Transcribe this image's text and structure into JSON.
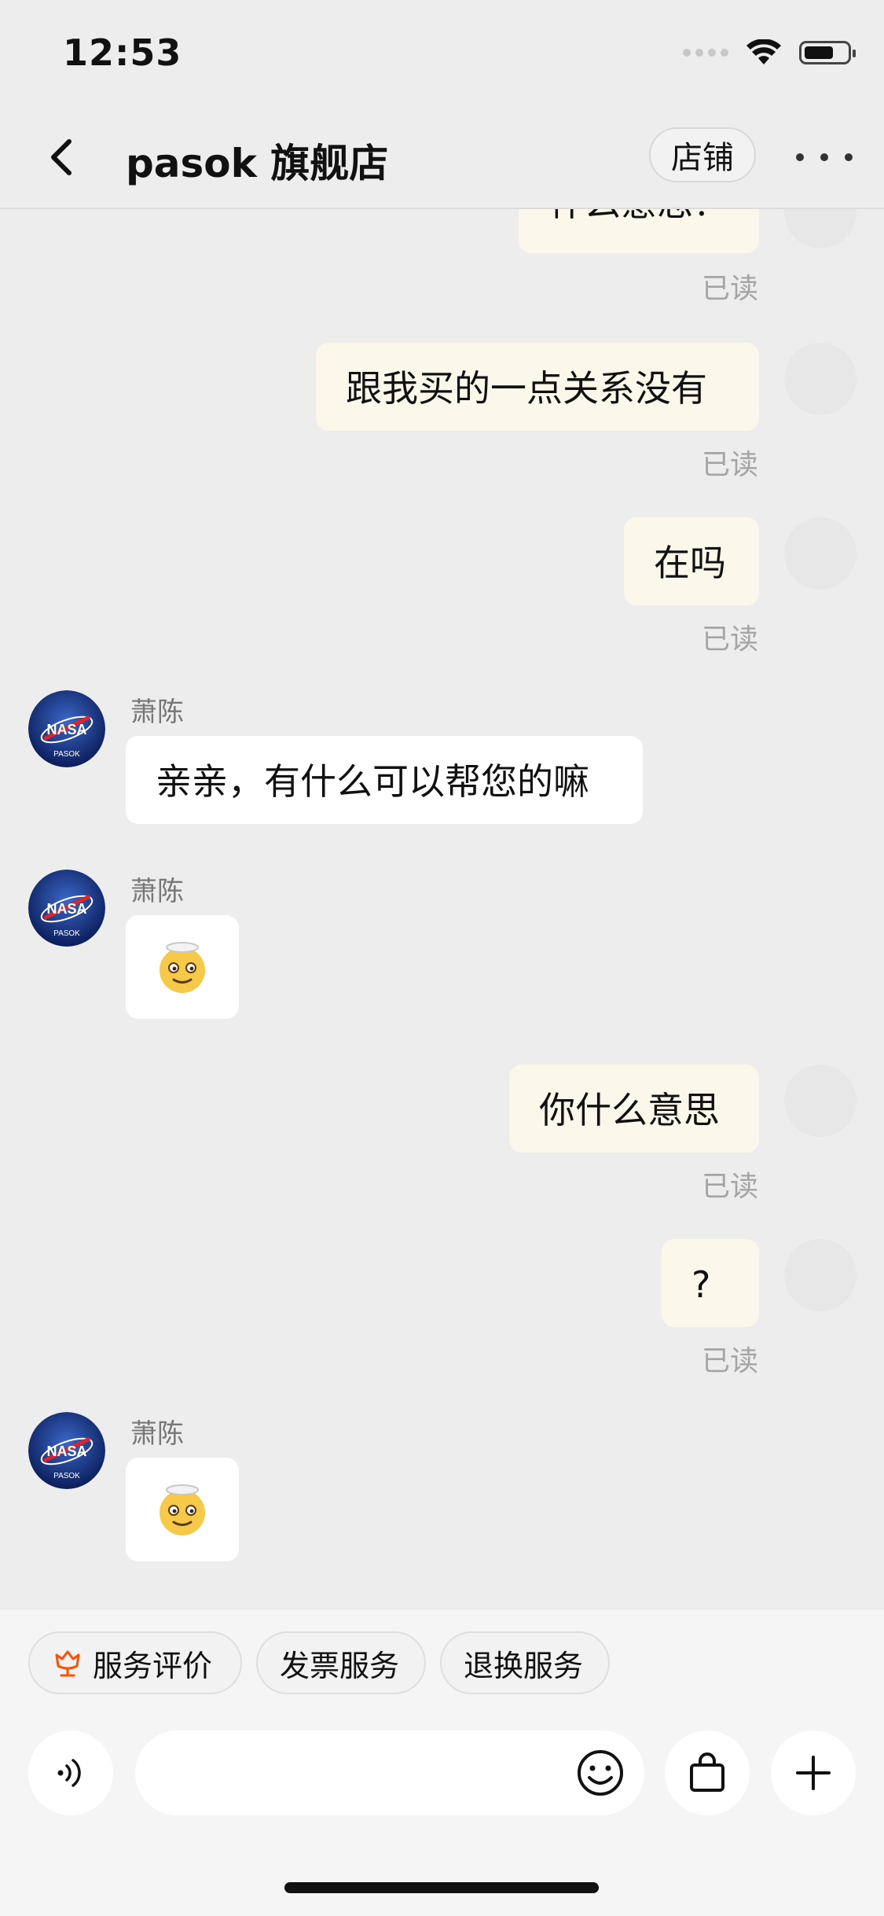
{
  "status_bar": {
    "time": "12:53"
  },
  "header": {
    "title": "pasok 旗舰店",
    "shop_button": "店铺"
  },
  "messages": {
    "m0": {
      "text": "什么意思？",
      "status": "已读"
    },
    "m1": {
      "text": "跟我买的一点关系没有",
      "status": "已读"
    },
    "m2": {
      "text": "在吗",
      "status": "已读"
    },
    "m3": {
      "sender": "萧陈",
      "text": "亲亲，有什么可以帮您的嘛"
    },
    "m4": {
      "sender": "萧陈",
      "emoji": "😇"
    },
    "m5": {
      "text": "你什么意思",
      "status": "已读"
    },
    "m6": {
      "text": "?",
      "status": "已读"
    },
    "m7": {
      "sender": "萧陈",
      "emoji": "😇"
    }
  },
  "shop_avatar": {
    "label": "NASA",
    "sub": "PASOK"
  },
  "quick_actions": [
    "服务评价",
    "发票服务",
    "退换服务"
  ],
  "composer": {
    "placeholder": ""
  },
  "colors": {
    "background": "#ededed",
    "outgoing_bubble": "#fbf7eb",
    "incoming_bubble": "#ffffff",
    "accent": "#ff5000"
  }
}
